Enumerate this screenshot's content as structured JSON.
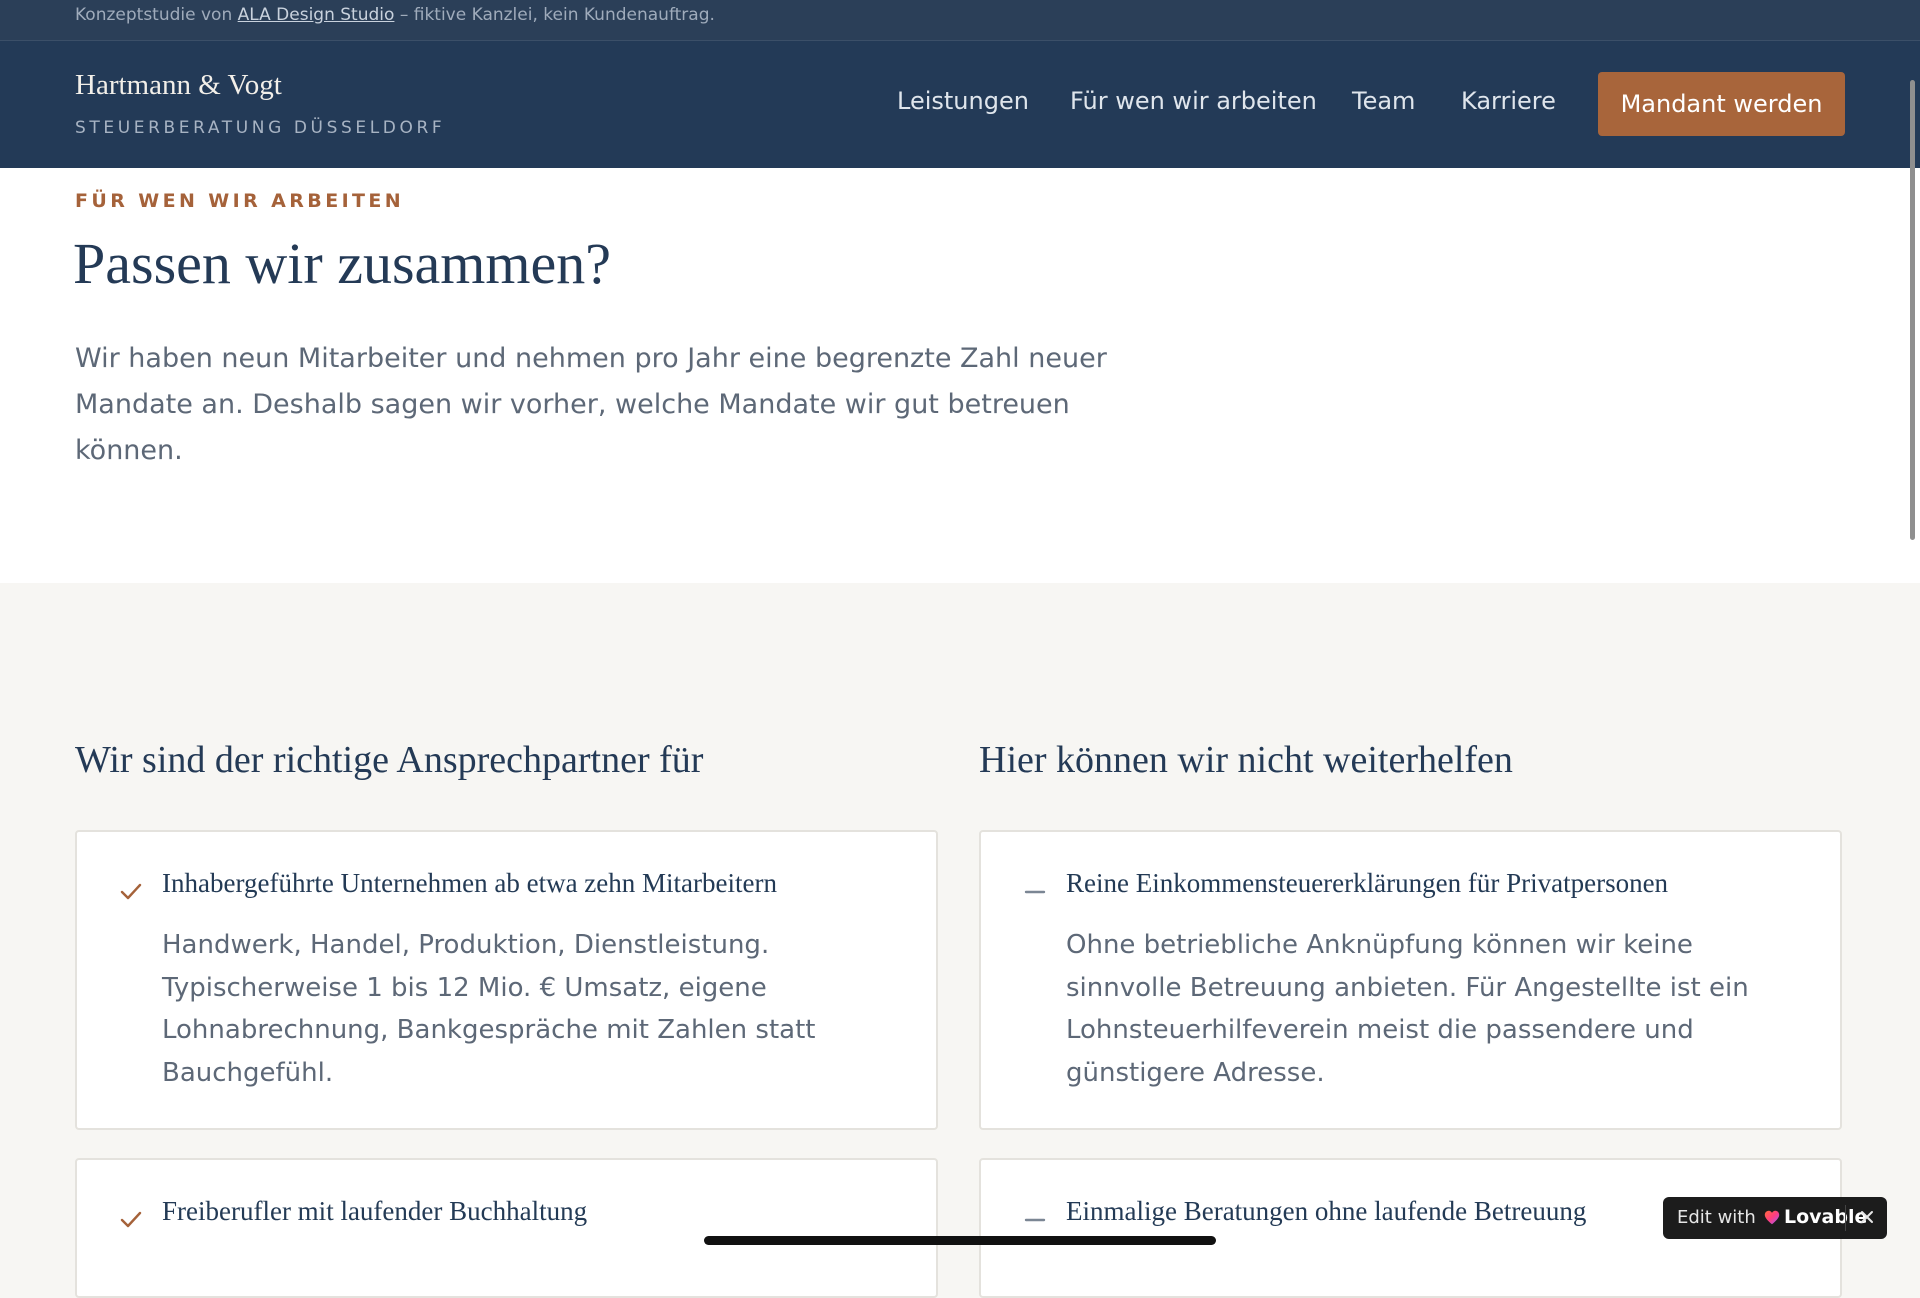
{
  "topbar": {
    "prefix": "Konzeptstudie von",
    "link": "ALA Design Studio",
    "suffix": "– fiktive Kanzlei, kein Kundenauftrag."
  },
  "header": {
    "brand_name": "Hartmann & Vogt",
    "brand_sub": "STEUERBERATUNG DÜSSELDORF",
    "nav": [
      "Leistungen",
      "Für wen wir arbeiten",
      "Team",
      "Karriere"
    ],
    "cta": "Mandant werden"
  },
  "hero": {
    "eyebrow": "FÜR WEN WIR ARBEITEN",
    "title": "Passen wir zusammen?",
    "lead_line1": "Wir haben neun Mitarbeiter und nehmen pro Jahr eine begrenzte Zahl neuer",
    "lead_line2": "Mandate an. Deshalb sagen wir vorher, welche Mandate wir gut betreuen können."
  },
  "fit": {
    "heading": "Wir sind der richtige Ansprechpartner für",
    "items": [
      {
        "title": "Inhabergeführte Unternehmen ab etwa zehn Mitarbeitern",
        "text": "Handwerk, Handel, Produktion, Dienstleistung. Typischerweise 1 bis 12 Mio. € Umsatz, eigene Lohnabrechnung, Bankgespräche mit Zahlen statt Bauchgefühl."
      },
      {
        "title": "Freiberufler mit laufender Buchhaltung",
        "text": ""
      }
    ]
  },
  "nofit": {
    "heading": "Hier können wir nicht weiterhelfen",
    "items": [
      {
        "title": "Reine Einkommensteuererklärungen für Privatpersonen",
        "text": "Ohne betriebliche Anknüpfung können wir keine sinnvolle Betreuung anbieten. Für Angestellte ist ein Lohnsteuerhilfeverein meist die passendere und günstigere Adresse."
      },
      {
        "title": "Einmalige Beratungen ohne laufende Betreuung",
        "text": ""
      }
    ]
  },
  "overlay": {
    "edit_with": "Edit with",
    "brand": "Lovable"
  },
  "colors": {
    "navy": "#233a57",
    "accent": "#a8653b",
    "background": "#f7f6f3"
  },
  "icons": [
    "check-icon",
    "dash-icon",
    "lovable-heart-icon",
    "close-icon"
  ]
}
